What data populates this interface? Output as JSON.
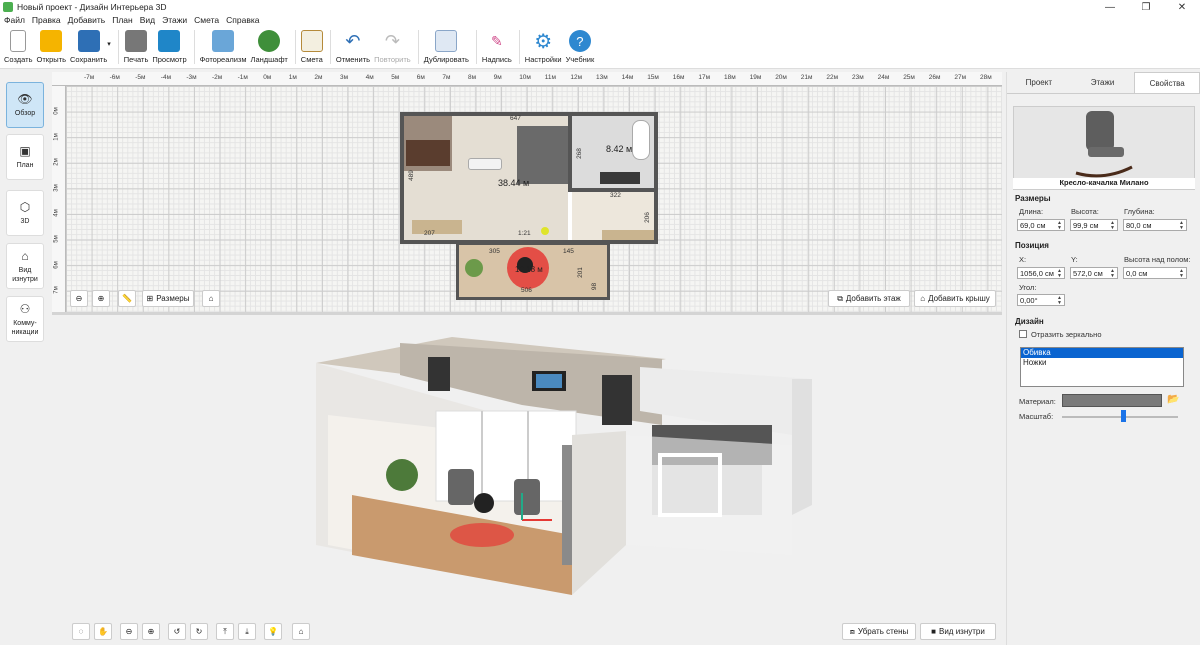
{
  "window": {
    "title": "Новый проект - Дизайн Интерьера 3D"
  },
  "menu": [
    "Файл",
    "Правка",
    "Добавить",
    "План",
    "Вид",
    "Этажи",
    "Смета",
    "Справка"
  ],
  "toolbar": {
    "create": "Создать",
    "open": "Открыть",
    "save": "Сохранить",
    "print": "Печать",
    "preview": "Просмотр",
    "photorealism": "Фотореализм",
    "landscape": "Ландшафт",
    "estimate": "Смета",
    "undo": "Отменить",
    "redo": "Повторить",
    "duplicate": "Дублировать",
    "label": "Надпись",
    "settings": "Настройки",
    "tutorial": "Учебник"
  },
  "sidebar": [
    {
      "label": "Обзор",
      "icon": "eye-icon"
    },
    {
      "label": "План",
      "icon": "plan-icon"
    },
    {
      "label": "3D",
      "icon": "cube-icon"
    },
    {
      "label": "Вид изнутри",
      "icon": "inside-view-icon"
    },
    {
      "label": "Комму- никации",
      "icon": "communications-icon"
    }
  ],
  "plan": {
    "ruler_x": [
      "-7м",
      "-6м",
      "-5м",
      "-4м",
      "-3м",
      "-2м",
      "-1м",
      "0м",
      "1м",
      "2м",
      "3м",
      "4м",
      "5м",
      "6м",
      "7м",
      "8м",
      "9м",
      "10м",
      "11м",
      "12м",
      "13м",
      "14м",
      "15м",
      "16м",
      "17м",
      "18м",
      "19м",
      "20м",
      "21м",
      "22м",
      "23м",
      "24м",
      "25м",
      "26м",
      "27м",
      "28м"
    ],
    "ruler_y": [
      "0м",
      "1м",
      "2м",
      "3м",
      "4м",
      "5м",
      "6м",
      "7м"
    ],
    "rooms": [
      {
        "area": "38.44 м"
      },
      {
        "area": "8.42 м"
      },
      {
        "area": "10.18 м"
      }
    ],
    "dimensions": [
      "647",
      "489",
      "268",
      "322",
      "206",
      "207",
      "305",
      "145",
      "201",
      "98",
      "506",
      "1:21"
    ],
    "buttons": {
      "sizes": "Размеры",
      "add_floor": "Добавить этаж",
      "add_roof": "Добавить крышу"
    }
  },
  "view3d": {
    "buttons": {
      "remove_walls": "Убрать стены",
      "inside_view": "Вид изнутри"
    }
  },
  "props": {
    "tabs": [
      "Проект",
      "Этажи",
      "Свойства"
    ],
    "object_name": "Кресло-качалка Милано",
    "size_title": "Размеры",
    "length_label": "Длина:",
    "length": "69,0 см",
    "height_label": "Высота:",
    "height": "99,9 см",
    "depth_label": "Глубина:",
    "depth": "80,0 см",
    "position_title": "Позиция",
    "x_label": "X:",
    "x": "1056,0 см",
    "y_label": "Y:",
    "y": "572,0 см",
    "elev_label": "Высота над полом:",
    "elev": "0,0 см",
    "angle_label": "Угол:",
    "angle": "0,00°",
    "design_title": "Дизайн",
    "mirror_label": "Отразить зеркально",
    "parts": [
      "Обивка",
      "Ножки"
    ],
    "material_label": "Материал:",
    "scale_label": "Масштаб:"
  },
  "colors": {
    "accent": "#0a64d0",
    "room_floor": "#e8e4dc",
    "wall": "#555555",
    "selection": "#e53935"
  }
}
